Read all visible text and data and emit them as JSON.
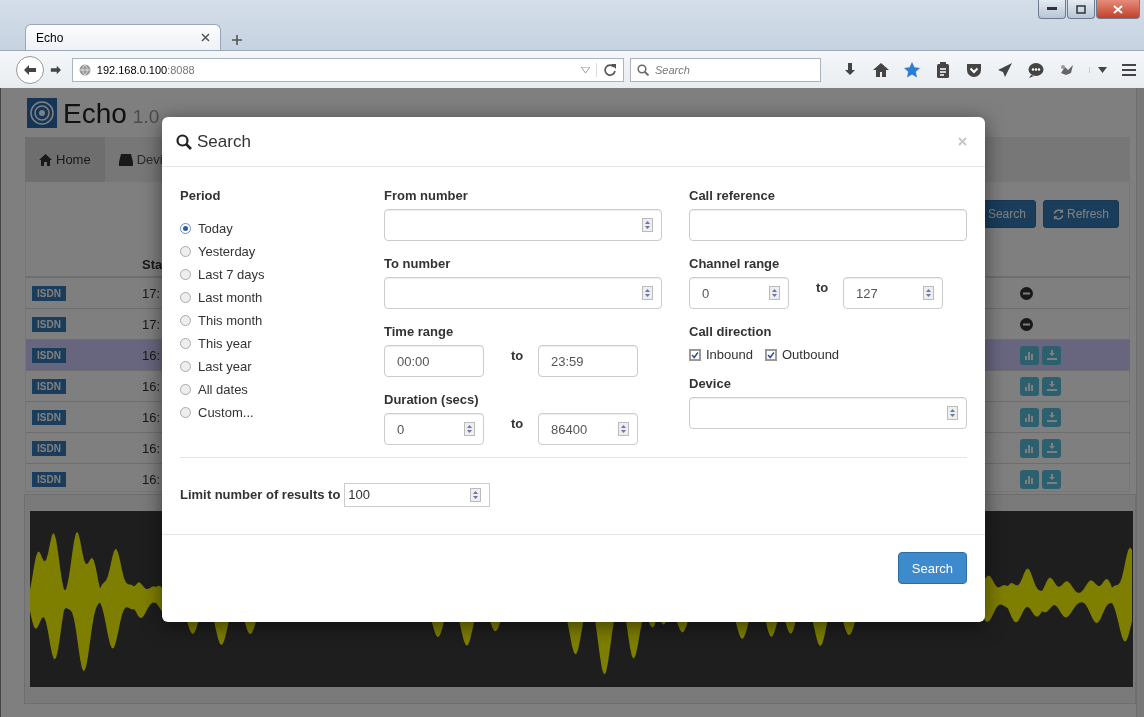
{
  "browser": {
    "tab_title": "Echo",
    "url_host": "192.168.0.100",
    "url_port": ":8088",
    "search_placeholder": "Search"
  },
  "app": {
    "name": "Echo",
    "version": "1.0",
    "nav_tabs": [
      {
        "label": "Home",
        "selected": true,
        "kind": "home"
      },
      {
        "label": "Devi",
        "selected": false,
        "kind": "device"
      }
    ],
    "toolbar_buttons": [
      {
        "label": "Search",
        "kind": "search"
      },
      {
        "label": "Refresh",
        "kind": "refresh"
      }
    ],
    "table": {
      "columns": [
        "Sta"
      ],
      "rows": [
        {
          "type": "ISDN",
          "start": "17:",
          "selected": false,
          "kind": "none"
        },
        {
          "type": "ISDN",
          "start": "17:",
          "selected": false,
          "kind": "none"
        },
        {
          "type": "ISDN",
          "start": "16:",
          "selected": true,
          "kind": "actions"
        },
        {
          "type": "ISDN",
          "start": "16:",
          "selected": false,
          "kind": "actions"
        },
        {
          "type": "ISDN",
          "start": "16:",
          "selected": false,
          "kind": "actions"
        },
        {
          "type": "ISDN",
          "start": "16:",
          "selected": false,
          "kind": "actions"
        },
        {
          "type": "ISDN",
          "start": "16:",
          "selected": false,
          "kind": "actions"
        }
      ]
    }
  },
  "modal": {
    "title": "Search",
    "period": {
      "label": "Period",
      "options": [
        {
          "label": "Today",
          "selected": true
        },
        {
          "label": "Yesterday",
          "selected": false
        },
        {
          "label": "Last 7 days",
          "selected": false
        },
        {
          "label": "Last month",
          "selected": false
        },
        {
          "label": "This month",
          "selected": false
        },
        {
          "label": "This year",
          "selected": false
        },
        {
          "label": "Last year",
          "selected": false
        },
        {
          "label": "All dates",
          "selected": false
        },
        {
          "label": "Custom...",
          "selected": false
        }
      ]
    },
    "middle": [
      {
        "kind": "single",
        "label": "From number",
        "spinner": true
      },
      {
        "kind": "single",
        "label": "To number",
        "spinner": true
      },
      {
        "kind": "range",
        "label": "Time range",
        "from": "00:00",
        "separator": "to",
        "to": "23:59",
        "spinner": false
      },
      {
        "kind": "range",
        "label": "Duration (secs)",
        "from": "0",
        "separator": "to",
        "to": "86400",
        "spinner": true
      }
    ],
    "right": [
      {
        "kind": "single",
        "label": "Call reference",
        "spinner": false
      },
      {
        "kind": "range",
        "label": "Channel range",
        "from": "0",
        "separator": "to",
        "to": "127",
        "spinner": true
      },
      {
        "kind": "checks",
        "label": "Call direction",
        "options": [
          {
            "label": "Inbound",
            "checked": true
          },
          {
            "label": "Outbound",
            "checked": true
          }
        ]
      },
      {
        "kind": "single",
        "label": "Device",
        "spinner": true
      }
    ],
    "limit": {
      "label": "Limit number of results to",
      "value": "100"
    },
    "submit": "Search"
  }
}
